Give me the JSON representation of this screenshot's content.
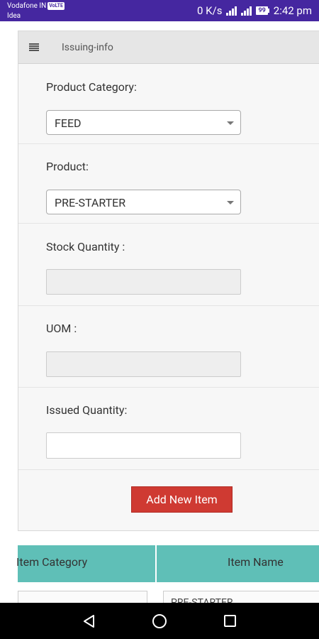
{
  "status_bar": {
    "carrier_line1": "Vodafone IN",
    "carrier_line1_tag": "VoLTE",
    "carrier_line2": "Idea",
    "network_speed": "0 K/s",
    "battery": "99",
    "time": "2:42 pm"
  },
  "header": {
    "title": "Issuing-info"
  },
  "form": {
    "product_category": {
      "label": "Product Category:",
      "value": "FEED"
    },
    "product": {
      "label": "Product:",
      "value": "PRE-STARTER"
    },
    "stock_quantity": {
      "label": "Stock Quantity :",
      "value": ""
    },
    "uom": {
      "label": "UOM :",
      "value": ""
    },
    "issued_quantity": {
      "label": "Issued Quantity:",
      "value": ""
    },
    "add_button_label": "Add New Item"
  },
  "table": {
    "headers": [
      "Item Category",
      "Item Name"
    ],
    "rows": [
      [
        "",
        "PRE-STARTER"
      ]
    ]
  },
  "colors": {
    "status_bar": "#4527a0",
    "button": "#cf3a32",
    "table_header": "#5fbfb7"
  }
}
